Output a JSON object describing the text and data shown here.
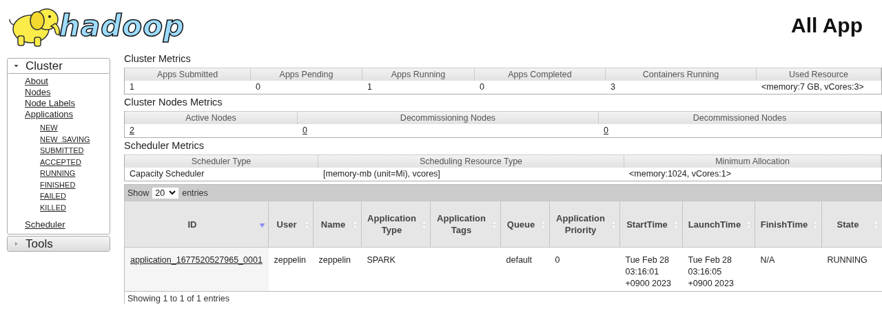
{
  "header": {
    "logo_text": "hadoop",
    "title": "All App"
  },
  "sidebar": [
    {
      "label": "Cluster",
      "expanded": true,
      "items": [
        {
          "label": "About"
        },
        {
          "label": "Nodes"
        },
        {
          "label": "Node Labels"
        },
        {
          "label": "Applications",
          "children": [
            {
              "label": "NEW"
            },
            {
              "label": "NEW_SAVING"
            },
            {
              "label": "SUBMITTED"
            },
            {
              "label": "ACCEPTED"
            },
            {
              "label": "RUNNING"
            },
            {
              "label": "FINISHED"
            },
            {
              "label": "FAILED"
            },
            {
              "label": "KILLED"
            }
          ]
        },
        {
          "label": "Scheduler"
        }
      ]
    },
    {
      "label": "Tools",
      "expanded": false
    }
  ],
  "metrics": [
    {
      "title": "Cluster Metrics",
      "columns": [
        "Apps Submitted",
        "Apps Pending",
        "Apps Running",
        "Apps Completed",
        "Containers Running",
        "Used Resource"
      ],
      "values": [
        {
          "text": "1",
          "link": false
        },
        {
          "text": "0",
          "link": false
        },
        {
          "text": "1",
          "link": false
        },
        {
          "text": "0",
          "link": false
        },
        {
          "text": "3",
          "link": false
        },
        {
          "text": "<memory:7 GB, vCores:3>",
          "link": false
        }
      ]
    },
    {
      "title": "Cluster Nodes Metrics",
      "columns": [
        "Active Nodes",
        "Decommissioning Nodes",
        "Decommissioned Nodes"
      ],
      "values": [
        {
          "text": "2",
          "link": true
        },
        {
          "text": "0",
          "link": true
        },
        {
          "text": "0",
          "link": true
        }
      ]
    },
    {
      "title": "Scheduler Metrics",
      "columns": [
        "Scheduler Type",
        "Scheduling Resource Type",
        "Minimum Allocation"
      ],
      "values": [
        {
          "text": "Capacity Scheduler",
          "link": false
        },
        {
          "text": "[memory-mb (unit=Mi), vcores]",
          "link": false
        },
        {
          "text": "<memory:1024, vCores:1>",
          "link": false
        }
      ]
    }
  ],
  "applications": {
    "show_label": "Show",
    "page_size": "20",
    "entries_label": "entries",
    "columns": [
      {
        "label": "ID",
        "sorted": true
      },
      {
        "label": "User",
        "sorted": false
      },
      {
        "label": "Name",
        "sorted": false
      },
      {
        "label": "Application Type",
        "sorted": false
      },
      {
        "label": "Application Tags",
        "sorted": false
      },
      {
        "label": "Queue",
        "sorted": false
      },
      {
        "label": "Application Priority",
        "sorted": false
      },
      {
        "label": "StartTime",
        "sorted": false
      },
      {
        "label": "LaunchTime",
        "sorted": false
      },
      {
        "label": "FinishTime",
        "sorted": false
      },
      {
        "label": "State",
        "sorted": false
      }
    ],
    "rows": [
      [
        "application_1677520527965_0001",
        "zeppelin",
        "zeppelin",
        "SPARK",
        "",
        "default",
        "0",
        "Tue Feb 28 03:16:01 +0900 2023",
        "Tue Feb 28 03:16:05 +0900 2023",
        "N/A",
        "RUNNING"
      ]
    ],
    "footer": "Showing 1 to 1 of 1 entries"
  }
}
